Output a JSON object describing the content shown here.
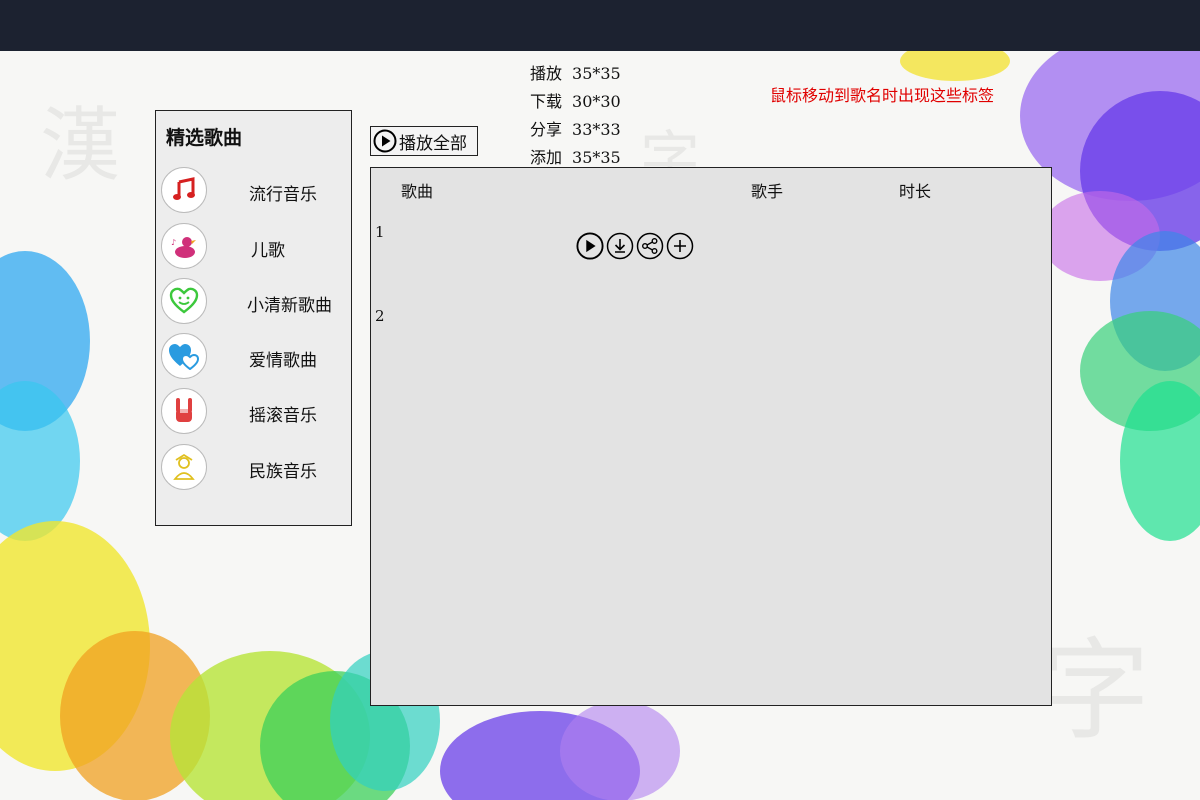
{
  "legend": [
    {
      "label": "播放",
      "size": "35*35"
    },
    {
      "label": "下载",
      "size": "30*30"
    },
    {
      "label": "分享",
      "size": "33*33"
    },
    {
      "label": "添加",
      "size": "35*35"
    }
  ],
  "hint": "鼠标移动到歌名时出现这些标签",
  "sidebar": {
    "title": "精选歌曲",
    "items": [
      {
        "label": "流行音乐",
        "icon": "music-note-icon",
        "color": "#d62020"
      },
      {
        "label": "儿歌",
        "icon": "duck-icon",
        "color": "#d0307a"
      },
      {
        "label": "小清新歌曲",
        "icon": "heart-smile-icon",
        "color": "#3cc83c"
      },
      {
        "label": "爱情歌曲",
        "icon": "hearts-icon",
        "color": "#2a9be0"
      },
      {
        "label": "摇滚音乐",
        "icon": "rock-hand-icon",
        "color": "#e04040"
      },
      {
        "label": "民族音乐",
        "icon": "person-icon",
        "color": "#e0c020"
      }
    ]
  },
  "toolbar": {
    "play_all": "播放全部"
  },
  "table": {
    "headers": {
      "song": "歌曲",
      "singer": "歌手",
      "duration": "时长"
    },
    "rows": [
      {
        "num": "1"
      },
      {
        "num": "2"
      }
    ]
  }
}
